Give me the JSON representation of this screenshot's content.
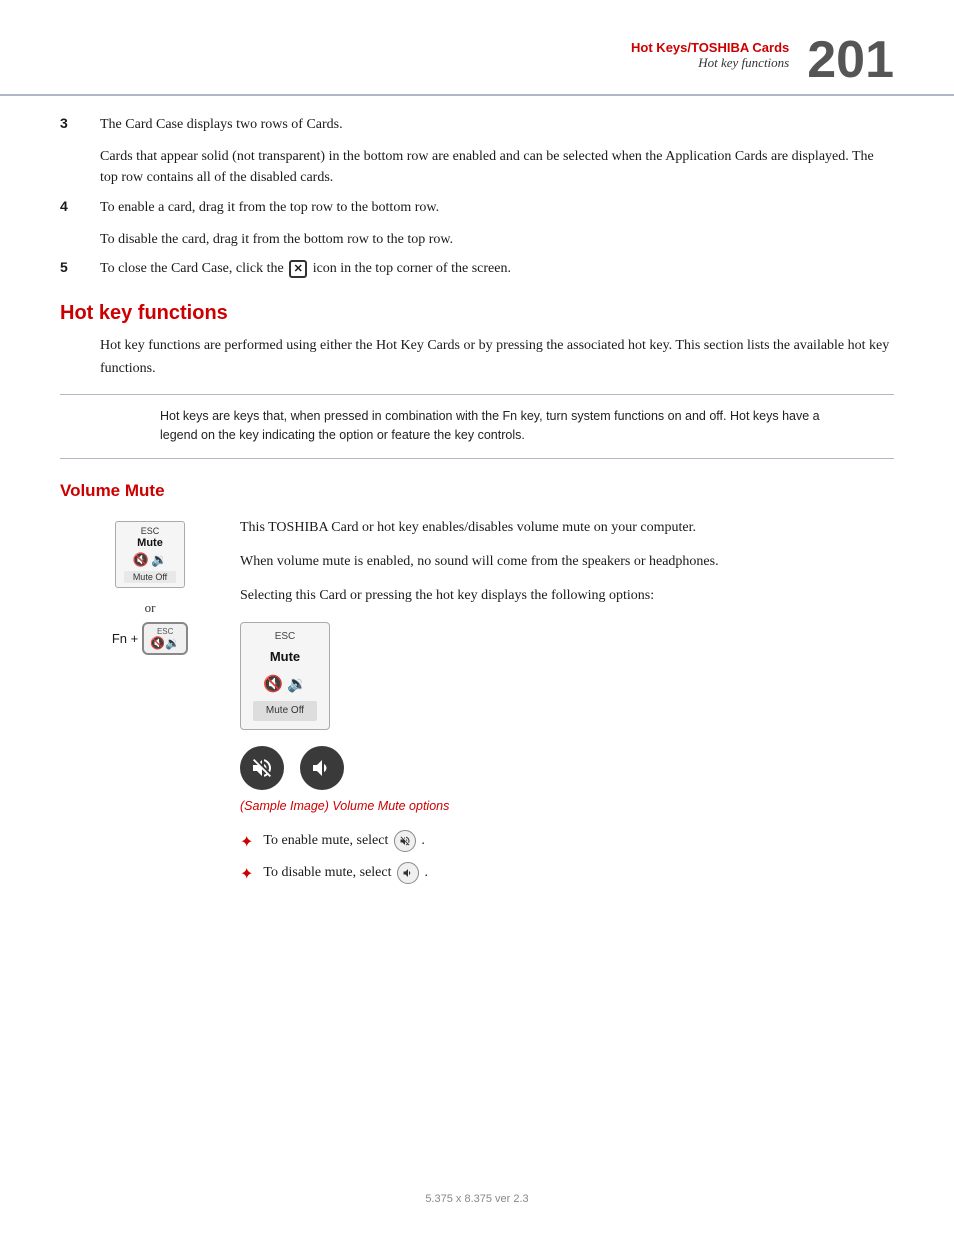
{
  "header": {
    "chapter": "Hot Keys/TOSHIBA Cards",
    "section": "Hot key functions",
    "page_number": "201"
  },
  "content": {
    "numbered_items": [
      {
        "number": "3",
        "text": "The Card Case displays two rows of Cards.",
        "sub": "Cards that appear solid (not transparent) in the bottom row are enabled and can be selected when the Application Cards are displayed. The top row contains all of the disabled cards."
      },
      {
        "number": "4",
        "text": "To enable a card, drag it from the top row to the bottom row.",
        "sub": "To disable the card, drag it from the bottom row to the top row."
      },
      {
        "number": "5",
        "text_before": "To close the Card Case, click the",
        "text_after": "icon in the top corner of the screen."
      }
    ],
    "hot_key_functions": {
      "heading": "Hot key functions",
      "intro": "Hot key functions are performed using either the Hot Key Cards or by pressing the associated hot key. This section lists the available hot key functions.",
      "note": "Hot keys are keys that, when pressed in combination with the Fn key, turn system functions on and off. Hot keys have a legend on the key indicating the option or feature the key controls."
    },
    "volume_mute": {
      "heading": "Volume Mute",
      "para1": "This TOSHIBA Card or hot key enables/disables volume mute on your computer.",
      "para2": "When volume mute is enabled, no sound will come from the speakers or headphones.",
      "para3": "Selecting this Card or pressing the hot key displays the following options:",
      "or_text": "or",
      "fn_text": "Fn +",
      "card_widget": {
        "esc": "ESC",
        "mute": "Mute",
        "mute_off": "Mute Off"
      },
      "sample_caption": "(Sample Image) Volume Mute options",
      "bullet1": "To enable mute, select",
      "bullet2": "To disable mute, select"
    }
  },
  "footer": {
    "text": "5.375 x 8.375 ver 2.3"
  }
}
